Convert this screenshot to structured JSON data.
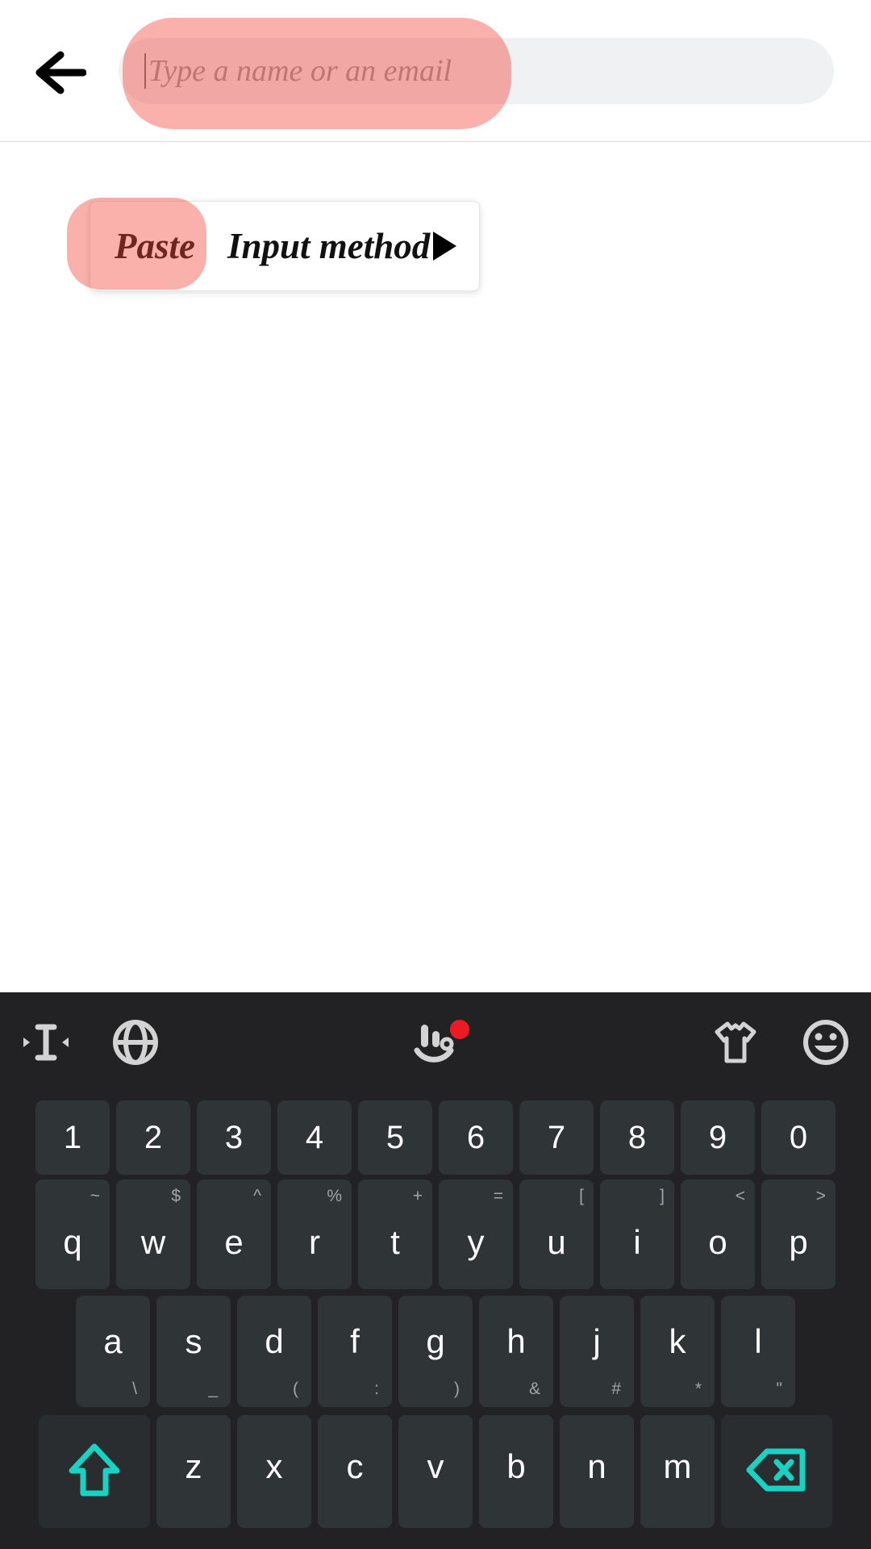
{
  "screen": {
    "app_bar": {
      "back_icon": "arrow-left-icon",
      "search_placeholder": "Type a name or an email",
      "search_value": ""
    },
    "context_menu": {
      "paste_label": "Paste",
      "input_method_label": "Input method",
      "submenu_arrow_icon": "triangle-right-icon"
    },
    "highlights": {
      "search_field_color": "#F44336",
      "paste_button_color": "#F44336"
    }
  },
  "keyboard": {
    "toolbar": [
      {
        "name": "cursor-move-icon",
        "label": "cursor-move"
      },
      {
        "name": "globe-icon",
        "label": "language"
      },
      {
        "name": "touchpal-logo-icon",
        "label": "menu",
        "badge": true
      },
      {
        "name": "tshirt-icon",
        "label": "theme"
      },
      {
        "name": "emoji-icon",
        "label": "emoji"
      }
    ],
    "rows": {
      "numbers": [
        {
          "main": "1",
          "alt": ""
        },
        {
          "main": "2",
          "alt": ""
        },
        {
          "main": "3",
          "alt": ""
        },
        {
          "main": "4",
          "alt": ""
        },
        {
          "main": "5",
          "alt": ""
        },
        {
          "main": "6",
          "alt": ""
        },
        {
          "main": "7",
          "alt": ""
        },
        {
          "main": "8",
          "alt": ""
        },
        {
          "main": "9",
          "alt": ""
        },
        {
          "main": "0",
          "alt": ""
        }
      ],
      "top": [
        {
          "main": "q",
          "alt": "~"
        },
        {
          "main": "w",
          "alt": "$"
        },
        {
          "main": "e",
          "alt": "^"
        },
        {
          "main": "r",
          "alt": "%"
        },
        {
          "main": "t",
          "alt": "+"
        },
        {
          "main": "y",
          "alt": "="
        },
        {
          "main": "u",
          "alt": "["
        },
        {
          "main": "i",
          "alt": "]"
        },
        {
          "main": "o",
          "alt": "<"
        },
        {
          "main": "p",
          "alt": ">"
        }
      ],
      "home": [
        {
          "main": "a",
          "alt": "\\"
        },
        {
          "main": "s",
          "alt": "_"
        },
        {
          "main": "d",
          "alt": "("
        },
        {
          "main": "f",
          "alt": ":"
        },
        {
          "main": "g",
          "alt": ")"
        },
        {
          "main": "h",
          "alt": "&"
        },
        {
          "main": "j",
          "alt": "#"
        },
        {
          "main": "k",
          "alt": "*"
        },
        {
          "main": "l",
          "alt": "\""
        }
      ],
      "bottom": [
        {
          "main": "z",
          "alt": ""
        },
        {
          "main": "x",
          "alt": ""
        },
        {
          "main": "c",
          "alt": ""
        },
        {
          "main": "v",
          "alt": ""
        },
        {
          "main": "b",
          "alt": ""
        },
        {
          "main": "n",
          "alt": ""
        },
        {
          "main": "m",
          "alt": ""
        }
      ],
      "shift_icon": "shift-up-arrow-icon",
      "backspace_icon": "backspace-icon"
    },
    "accent_color": "#18D3C4",
    "key_color": "#2F3437",
    "background_color": "#222224"
  }
}
